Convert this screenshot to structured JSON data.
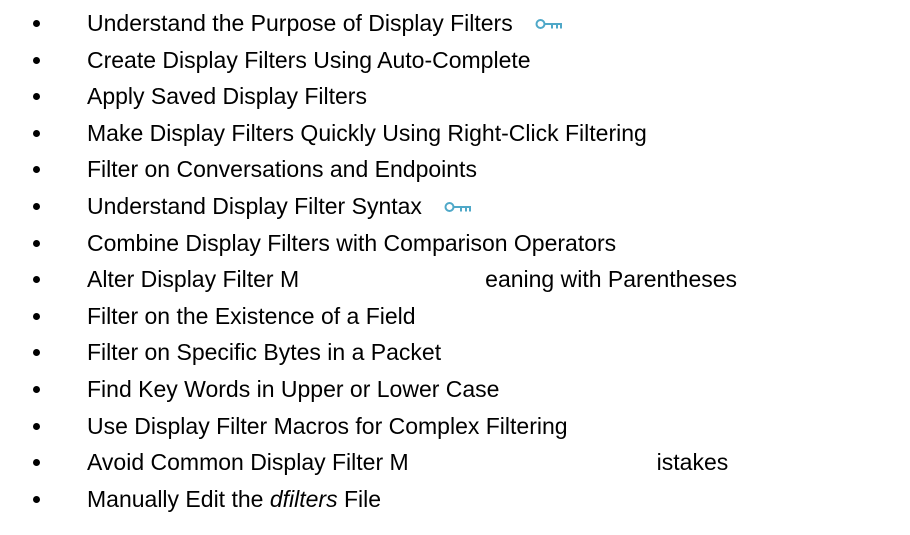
{
  "topics": [
    {
      "text": "Understand the Purpose of Display Filters",
      "key_icon": true
    },
    {
      "text": "Create Display Filters Using Auto-Complete"
    },
    {
      "text": "Apply Saved Display Filters"
    },
    {
      "text": "Make Display Filters Quickly Using Right-Click Filtering"
    },
    {
      "text": "Filter on Conversations and Endpoints"
    },
    {
      "text": "Understand Display Filter Syntax",
      "key_icon": true
    },
    {
      "text": "Combine Display Filters with Comparison Operators"
    },
    {
      "text_part1": "Alter Display Filter M",
      "text_part2": "eaning with Parentheses"
    },
    {
      "text": "Filter on the Existence of a Field"
    },
    {
      "text": "Filter on Specific Bytes in a Packet"
    },
    {
      "text": "Find Key Words in Upper or Lower Case"
    },
    {
      "text": "Use Display Filter Macros for Complex Filtering"
    },
    {
      "text_part1": "Avoid Common Display Filter M",
      "text_part2": "istakes"
    },
    {
      "text_before": "Manually Edit the ",
      "text_italic": "dfilters",
      "text_after": " File"
    }
  ],
  "colors": {
    "text": "#000000",
    "key_icon": "#4fa8c8"
  },
  "icons": {
    "key": "key-icon"
  }
}
